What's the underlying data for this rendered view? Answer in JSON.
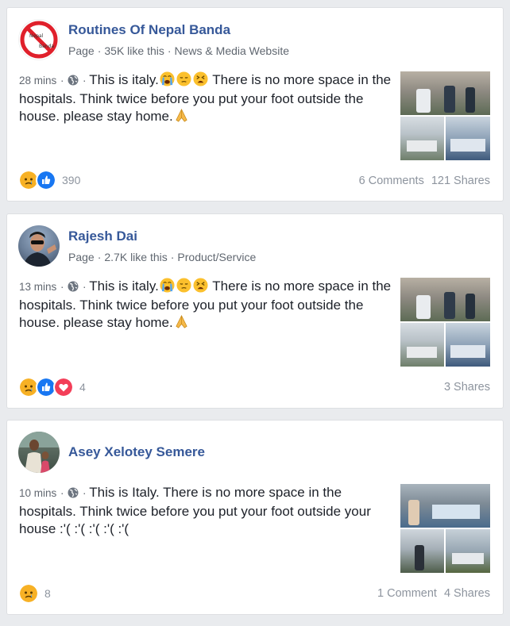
{
  "colors": {
    "link_blue": "#365899",
    "text": "#1d2129",
    "muted": "#606770",
    "background": "#e9ebee",
    "like_blue": "#1877f2",
    "love_red": "#f33e58",
    "sad_yellow": "#f7b125"
  },
  "posts": [
    {
      "author": "Routines Of Nepal Banda",
      "avatar_icon": "no-entry-logo-icon",
      "page_type": "Page",
      "likes": "35K like this",
      "category": "News & Media Website",
      "time": "28 mins",
      "privacy_icon": "globe-icon",
      "text_before_emoji": "This is italy.",
      "emojis": [
        "loudly-crying-face",
        "pensive-face",
        "tired-face"
      ],
      "text_after_emoji": "There is no more space in the hospitals. Think twice before you put your foot outside the house. please stay home.",
      "end_emoji": "folded-hands",
      "reactions": [
        "sad",
        "like"
      ],
      "reaction_count": "390",
      "comments": "6 Comments",
      "shares": "121 Shares"
    },
    {
      "author": "Rajesh Dai",
      "avatar_icon": "profile-photo",
      "page_type": "Page",
      "likes": "2.7K like this",
      "category": "Product/Service",
      "time": "13 mins",
      "privacy_icon": "globe-icon",
      "text_before_emoji": "This is italy.",
      "emojis": [
        "loudly-crying-face",
        "pensive-face",
        "tired-face"
      ],
      "text_after_emoji": "There is no more space in the hospitals. Think twice before you put your foot outside the house. please stay home.",
      "end_emoji": "folded-hands",
      "reactions": [
        "sad",
        "like",
        "love"
      ],
      "reaction_count": "4",
      "comments": "",
      "shares": "3 Shares"
    },
    {
      "author": "Asey Xelotey Semere",
      "avatar_icon": "profile-photo",
      "time": "10 mins",
      "privacy_icon": "globe-icon",
      "text": "This is Italy. There is no more space in the hospitals. Think twice before you put your foot outside your house :'( :'( :'( :'( :'(",
      "reactions": [
        "sad"
      ],
      "reaction_count": "8",
      "comments": "1 Comment",
      "shares": "4 Shares"
    }
  ]
}
